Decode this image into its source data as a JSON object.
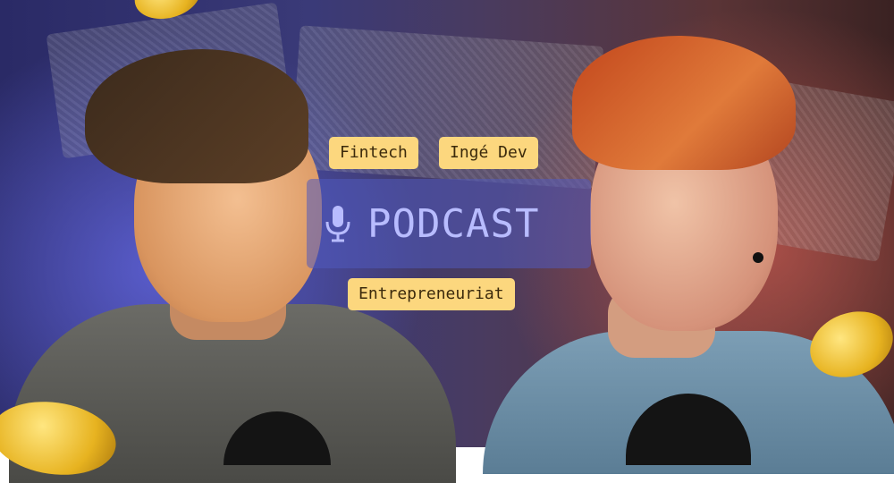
{
  "tags": {
    "fintech": "Fintech",
    "inge_dev": "Ingé Dev",
    "entrepreneuriat": "Entrepreneuriat"
  },
  "podcast": {
    "label": "PODCAST",
    "icon": "microphone-icon"
  },
  "colors": {
    "tag_bg": "#fcd77e",
    "tag_text": "#3b2a0c",
    "podcast_text": "#b8bcff",
    "podcast_panel": "#505abe"
  }
}
